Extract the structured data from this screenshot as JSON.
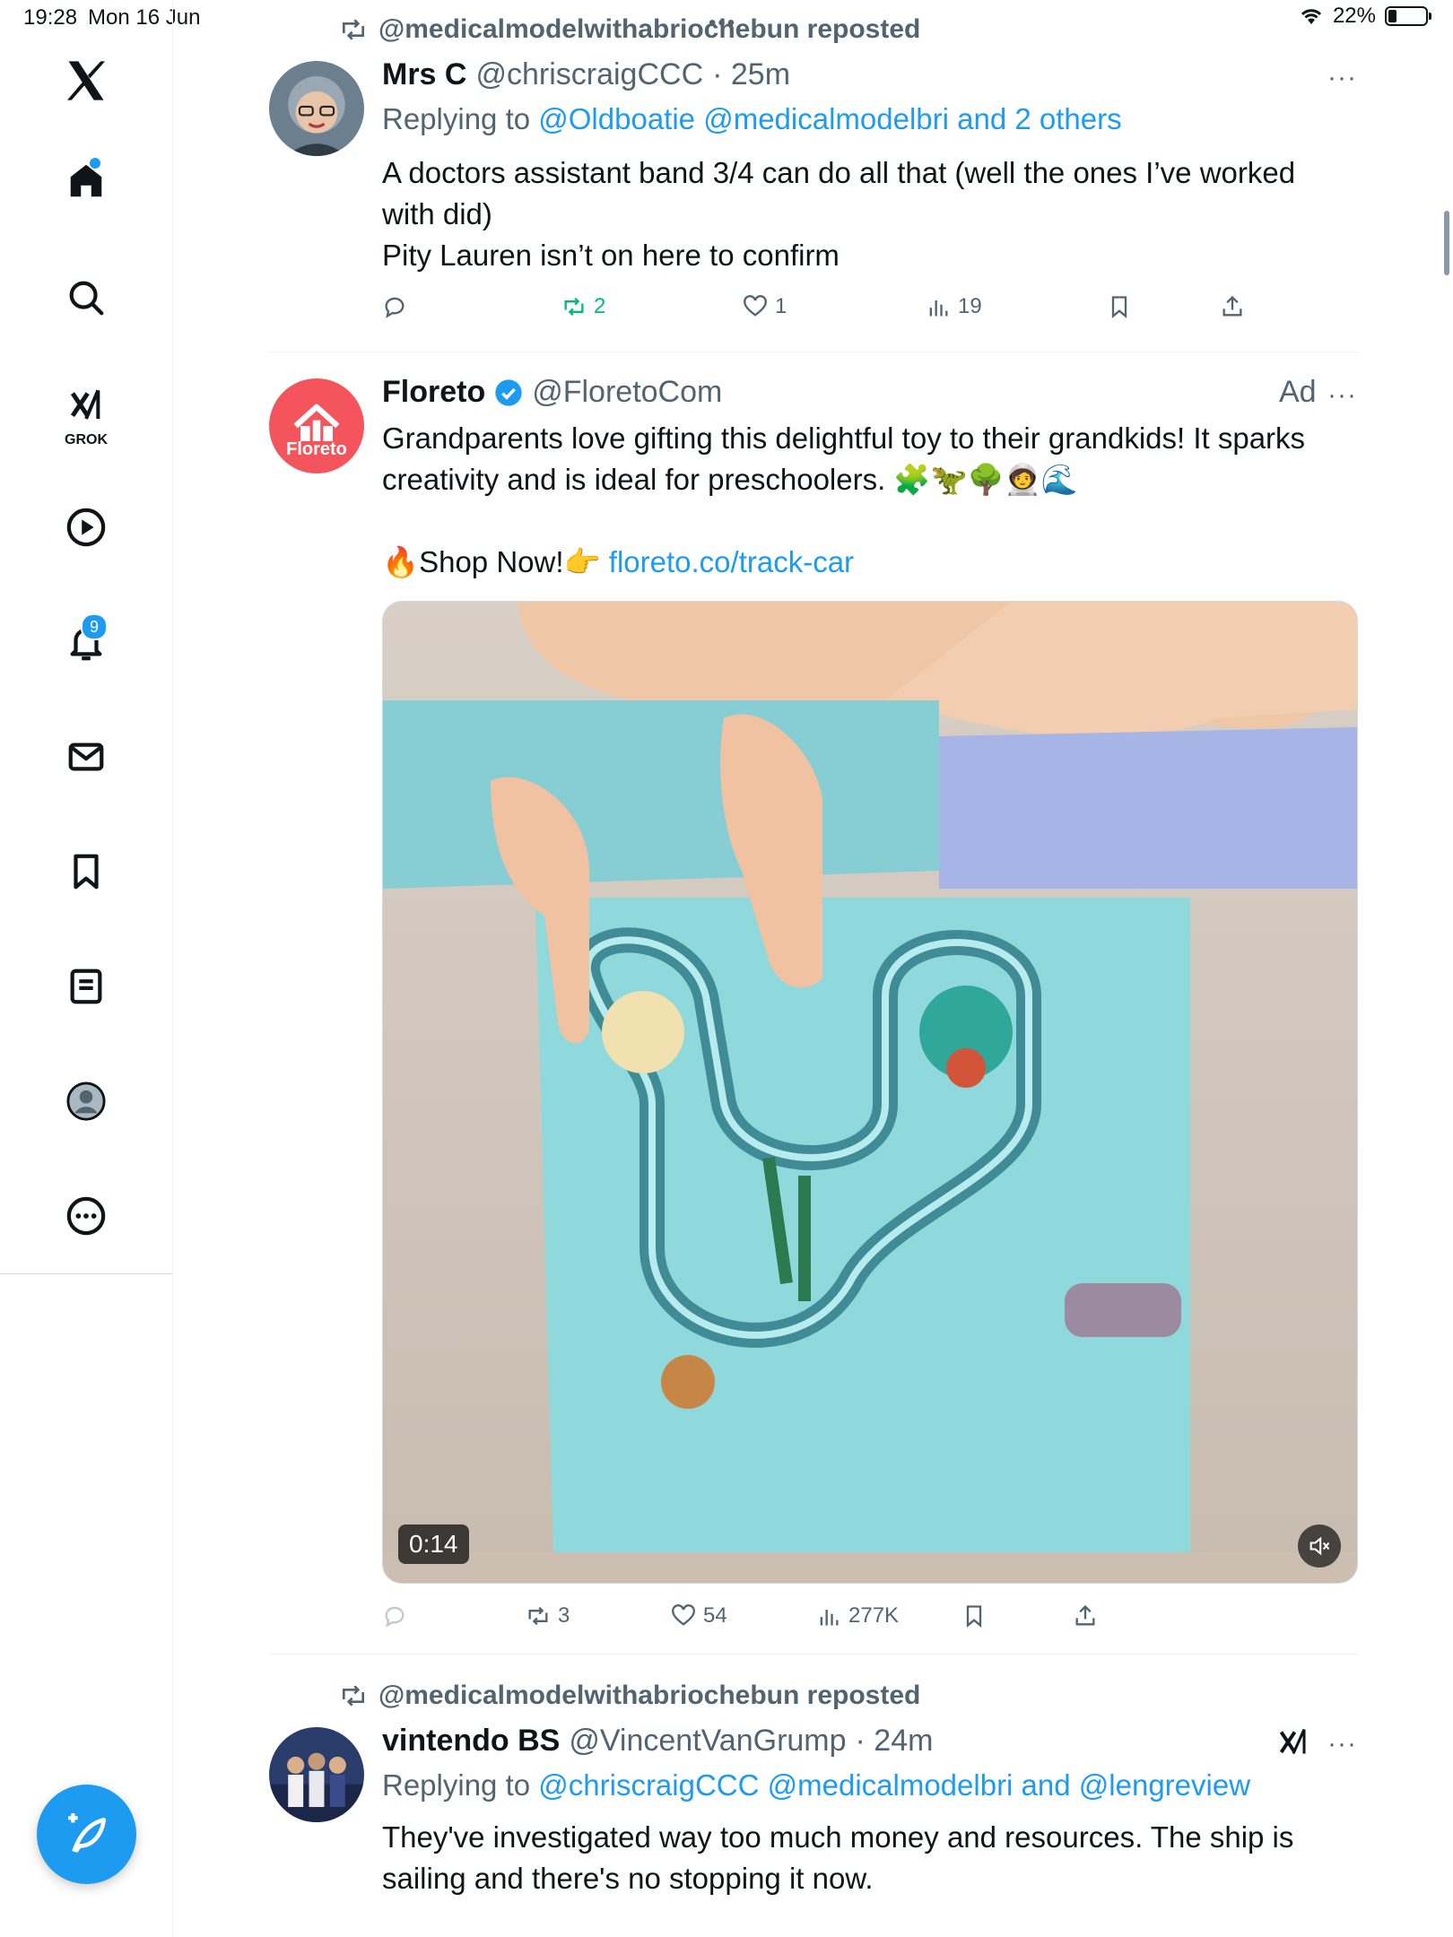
{
  "status_bar": {
    "time": "19:28",
    "date": "Mon 16 Jun",
    "battery": "22%"
  },
  "sidebar": {
    "items": [
      {
        "name": "home",
        "icon": "home-icon"
      },
      {
        "name": "explore",
        "icon": "search-icon"
      },
      {
        "name": "grok",
        "icon": "grok-icon",
        "label": "GROK"
      },
      {
        "name": "video",
        "icon": "play-icon"
      },
      {
        "name": "notifications",
        "icon": "bell-icon",
        "badge": "9"
      },
      {
        "name": "messages",
        "icon": "mail-icon"
      },
      {
        "name": "bookmarks",
        "icon": "bookmark-icon"
      },
      {
        "name": "lists",
        "icon": "list-icon"
      },
      {
        "name": "profile",
        "icon": "avatar-icon"
      },
      {
        "name": "more",
        "icon": "more-icon"
      }
    ]
  },
  "posts": [
    {
      "repost_by": "@medicalmodelwithabriochebun reposted",
      "name": "Mrs C",
      "handle": "@chriscraigCCC",
      "time": "· 25m",
      "reply_prefix": "Replying to ",
      "reply_to": "@Oldboatie @medicalmodelbri and 2 others",
      "text_lines": [
        "A doctors assistant band 3/4 can do all that (well the ones I’ve worked",
        "with did)",
        "Pity Lauren isn’t on here to confirm"
      ],
      "retweets": "2",
      "likes": "1",
      "views": "19",
      "more": "···"
    },
    {
      "name": "Floreto",
      "handle": "@FloretoCom",
      "ad_label": "Ad",
      "avatar_text": "Floreto",
      "text_lines": [
        "Grandparents love gifting this delightful toy to their grandkids! It sparks",
        "creativity and is ideal for preschoolers. 🧩🦖🌳🧑‍🚀🌊"
      ],
      "cta": "🔥Shop Now!👉 ",
      "link": "floreto.co/track-car",
      "video_time": "0:14",
      "retweets": "3",
      "likes": "54",
      "views": "277K",
      "more": "···"
    },
    {
      "repost_by": "@medicalmodelwithabriochebun reposted",
      "name": "vintendo BS",
      "handle": "@VincentVanGrump",
      "time": "· 24m",
      "reply_prefix": "Replying to ",
      "reply_to": "@chriscraigCCC @medicalmodelbri and @lengreview",
      "text_lines": [
        "They've investigated way too much money and resources. The ship is",
        "sailing and there's no stopping it now."
      ],
      "more": "···"
    }
  ],
  "colors": {
    "accent": "#1d9bf0",
    "retweet_active": "#00ba7c",
    "muted": "#536471",
    "ad_avatar": "#f4545b"
  }
}
